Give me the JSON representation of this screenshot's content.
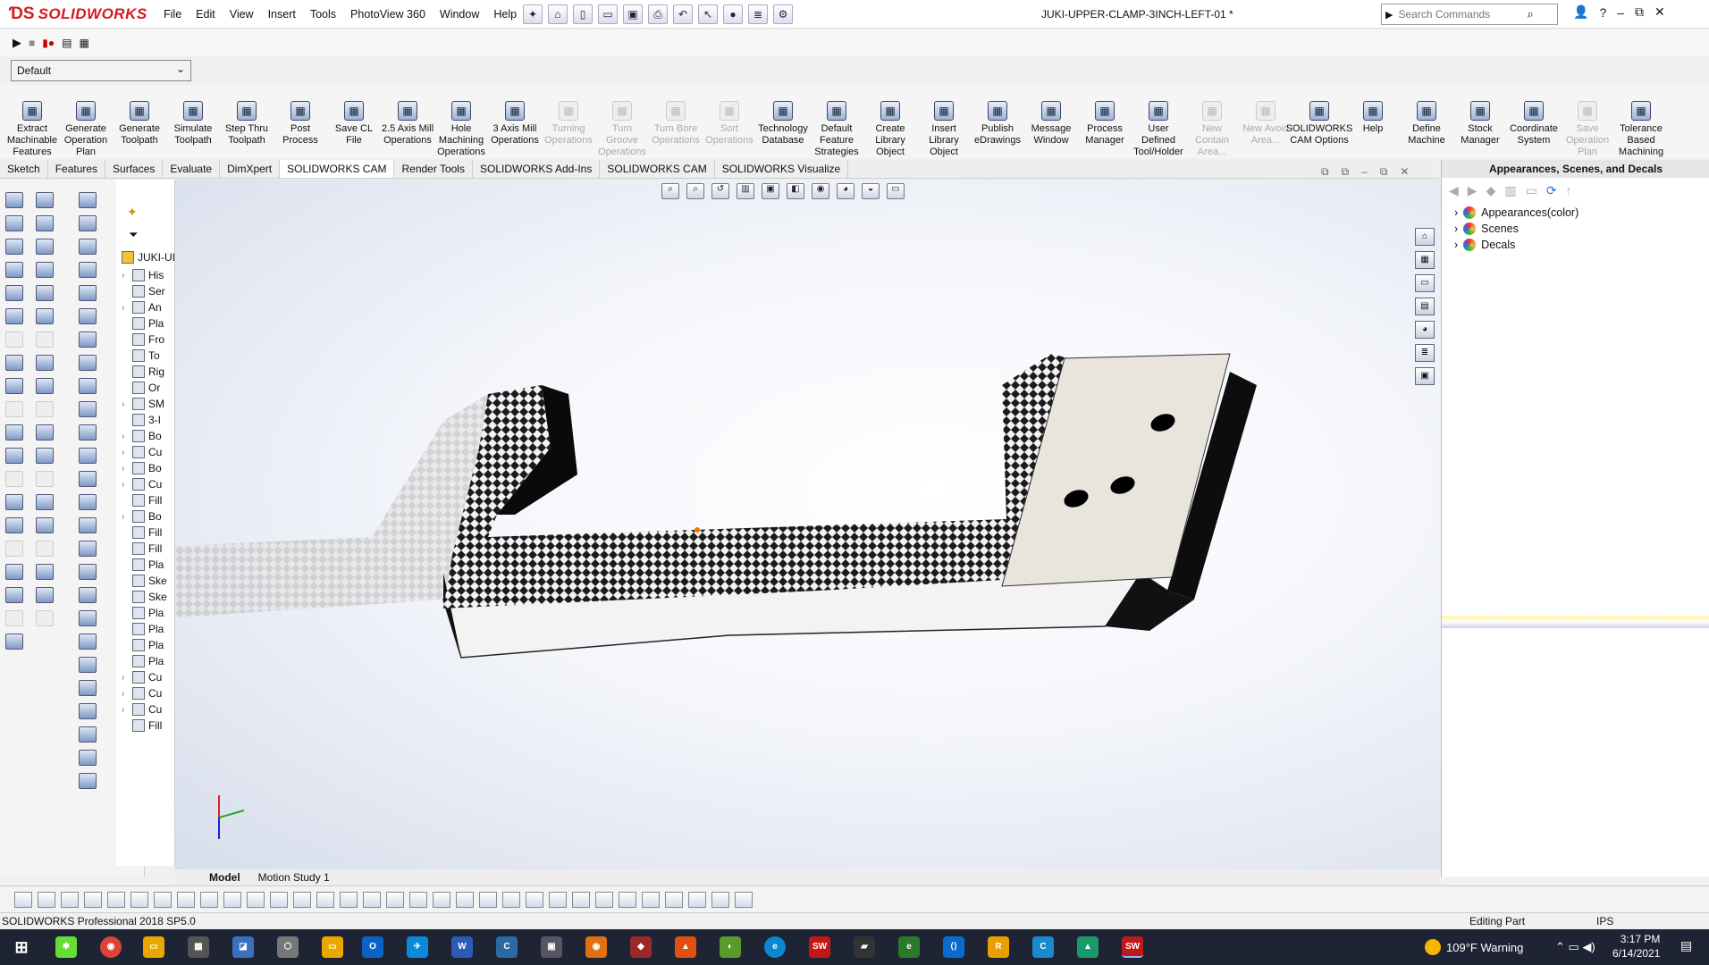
{
  "app": {
    "brand": "SOLIDWORKS",
    "document_title": "JUKI-UPPER-CLAMP-3INCH-LEFT-01 *"
  },
  "menus": [
    "File",
    "Edit",
    "View",
    "Insert",
    "Tools",
    "PhotoView 360",
    "Window",
    "Help"
  ],
  "search": {
    "placeholder": "Search Commands"
  },
  "configuration": {
    "selected": "Default"
  },
  "ribbon": [
    {
      "label": "Extract Machinable Features",
      "enabled": true
    },
    {
      "label": "Generate Operation Plan",
      "enabled": true
    },
    {
      "label": "Generate Toolpath",
      "enabled": true
    },
    {
      "label": "Simulate Toolpath",
      "enabled": true
    },
    {
      "label": "Step Thru Toolpath",
      "enabled": true
    },
    {
      "label": "Post Process",
      "enabled": true
    },
    {
      "label": "Save CL File",
      "enabled": true
    },
    {
      "label": "2.5 Axis Mill Operations",
      "enabled": true
    },
    {
      "label": "Hole Machining Operations",
      "enabled": true
    },
    {
      "label": "3 Axis Mill Operations",
      "enabled": true
    },
    {
      "label": "Turning Operations",
      "enabled": false
    },
    {
      "label": "Turn Groove Operations",
      "enabled": false
    },
    {
      "label": "Turn Bore Operations",
      "enabled": false
    },
    {
      "label": "Sort Operations",
      "enabled": false
    },
    {
      "label": "Technology Database",
      "enabled": true
    },
    {
      "label": "Default Feature Strategies",
      "enabled": true
    },
    {
      "label": "Create Library Object",
      "enabled": true
    },
    {
      "label": "Insert Library Object",
      "enabled": true
    },
    {
      "label": "Publish eDrawings",
      "enabled": true
    },
    {
      "label": "Message Window",
      "enabled": true
    },
    {
      "label": "Process Manager",
      "enabled": true
    },
    {
      "label": "User Defined Tool/Holder",
      "enabled": true
    },
    {
      "label": "New Contain Area...",
      "enabled": false
    },
    {
      "label": "New Avoid Area...",
      "enabled": false
    },
    {
      "label": "SOLIDWORKS CAM Options",
      "enabled": true
    },
    {
      "label": "Help",
      "enabled": true
    },
    {
      "label": "Define Machine",
      "enabled": true
    },
    {
      "label": "Stock Manager",
      "enabled": true
    },
    {
      "label": "Coordinate System",
      "enabled": true
    },
    {
      "label": "Save Operation Plan",
      "enabled": false
    },
    {
      "label": "Tolerance Based Machining",
      "enabled": true
    }
  ],
  "tabs": [
    "Sketch",
    "Features",
    "Surfaces",
    "Evaluate",
    "DimXpert",
    "SOLIDWORKS CAM",
    "Render Tools",
    "SOLIDWORKS Add-Ins",
    "SOLIDWORKS CAM",
    "SOLIDWORKS Visualize"
  ],
  "active_tab_index": 5,
  "feature_tree": {
    "root": "JUKI-UI",
    "items": [
      {
        "label": "His",
        "expand": true
      },
      {
        "label": "Ser",
        "expand": false
      },
      {
        "label": "An",
        "expand": true
      },
      {
        "label": "Pla",
        "expand": false
      },
      {
        "label": "Fro",
        "expand": false
      },
      {
        "label": "To",
        "expand": false
      },
      {
        "label": "Rig",
        "expand": false
      },
      {
        "label": "Or",
        "expand": false
      },
      {
        "label": "SM",
        "expand": true
      },
      {
        "label": "3-I",
        "expand": false
      },
      {
        "label": "Bo",
        "expand": true
      },
      {
        "label": "Cu",
        "expand": true
      },
      {
        "label": "Bo",
        "expand": true
      },
      {
        "label": "Cu",
        "expand": true
      },
      {
        "label": "Fill",
        "expand": false
      },
      {
        "label": "Bo",
        "expand": true
      },
      {
        "label": "Fill",
        "expand": false
      },
      {
        "label": "Fill",
        "expand": false
      },
      {
        "label": "Pla",
        "expand": false
      },
      {
        "label": "Ske",
        "expand": false
      },
      {
        "label": "Ske",
        "expand": false
      },
      {
        "label": "Pla",
        "expand": false
      },
      {
        "label": "Pla",
        "expand": false
      },
      {
        "label": "Pla",
        "expand": false
      },
      {
        "label": "Pla",
        "expand": false
      },
      {
        "label": "Cu",
        "expand": true
      },
      {
        "label": "Cu",
        "expand": true
      },
      {
        "label": "Cu",
        "expand": true
      },
      {
        "label": "Fill",
        "expand": false
      }
    ]
  },
  "bottom_tabs": [
    "Model",
    "Motion Study 1"
  ],
  "right_panel": {
    "title": "Appearances, Scenes, and Decals",
    "items": [
      "Appearances(color)",
      "Scenes",
      "Decals"
    ]
  },
  "status": {
    "left": "SOLIDWORKS Professional 2018 SP5.0",
    "mode": "Editing Part",
    "units": "IPS"
  },
  "taskbar": {
    "weather": "109°F  Warning",
    "time": "3:17 PM",
    "date": "6/14/2021"
  }
}
